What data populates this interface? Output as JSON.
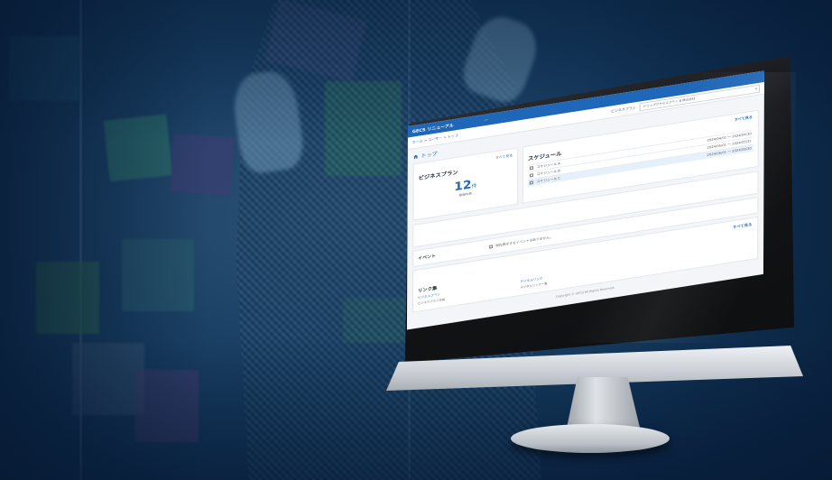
{
  "app": {
    "brand": "GECS リニューアル",
    "separator": "ー",
    "breadcrumb": "ホーム > ユーザー > トップ",
    "selector_label": "ビジネスプラン",
    "selector_value": "ドリップアクセスプラン B 株式会社"
  },
  "page": {
    "title": "トップ"
  },
  "business_plan": {
    "heading": "ビジネスプラン",
    "more_label": "すべて見る",
    "count": "12",
    "unit": "件",
    "caption": "登録件数"
  },
  "schedule": {
    "heading": "スケジュール",
    "more_label": "すべて見る",
    "items": [
      {
        "label": "スケジュール A",
        "date": "2024/04/01 ～ 2024/04/30"
      },
      {
        "label": "スケジュール B",
        "date": "2024/05/01 ～ 2024/05/31"
      },
      {
        "label": "スケジュール C",
        "date": "2024/06/01 ～ 2024/06/30"
      }
    ]
  },
  "event": {
    "heading": "イベント",
    "message": "現在表示するイベントはありません。"
  },
  "links": {
    "more_label": "すべて見る",
    "heading": "リンク集",
    "items": [
      {
        "title": "ビジネスプラン",
        "desc": "ビジネスプラン作成"
      },
      {
        "title": "デジタルリンク",
        "desc": "デジタルリンク一覧"
      }
    ]
  },
  "footer": {
    "text": "Copyright © GECS All Rights Reserved."
  },
  "colors": {
    "accent": "#1f67b8",
    "background": "#0e2f56"
  }
}
